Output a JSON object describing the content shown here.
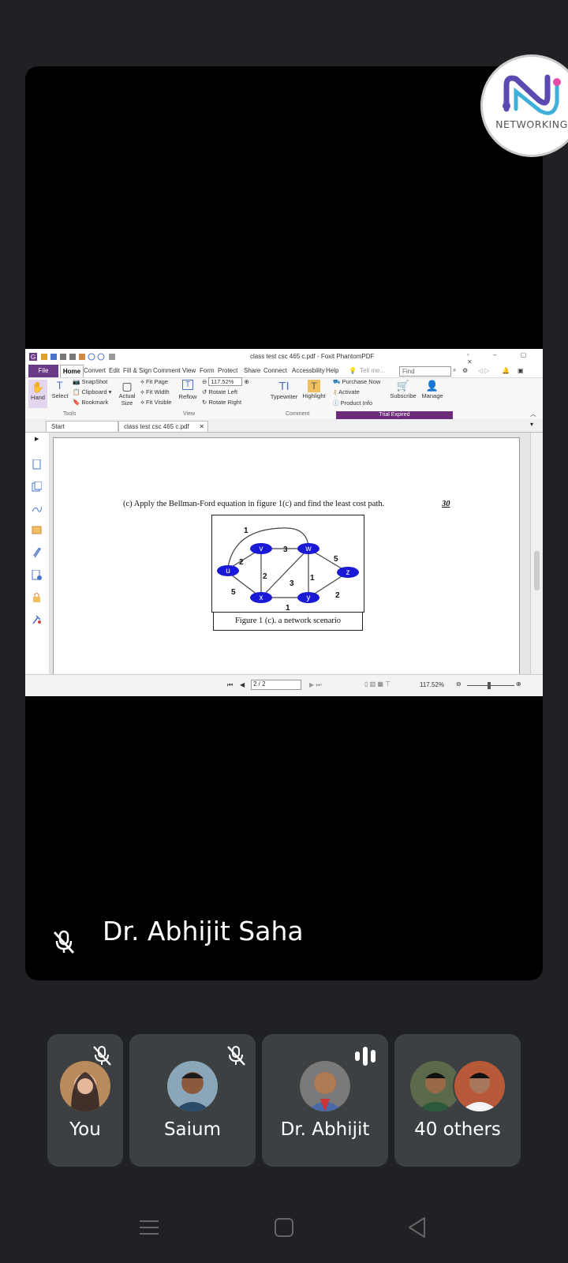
{
  "badge": {
    "label": "NETWORKING"
  },
  "pdf": {
    "window_title": "class test csc 465 c.pdf - Foxit PhantomPDF",
    "menu": [
      "File",
      "Home",
      "Convert",
      "Edit",
      "Fill & Sign",
      "Comment",
      "View",
      "Form",
      "Protect",
      "Share",
      "Connect",
      "Accessbility",
      "Help"
    ],
    "tell_me": "Tell me...",
    "find_placeholder": "Find",
    "ribbon": {
      "hand": "Hand",
      "select": "Select",
      "snapshot": "SnapShot",
      "clipboard": "Clipboard",
      "bookmark": "Bookmark",
      "actual_size": "Actual Size",
      "fit_page": "Fit Page",
      "fit_width": "Fit Width",
      "fit_visible": "Fit Visible",
      "reflow": "Reflow",
      "zoom": "117.52%",
      "rotate_left": "Rotate Left",
      "rotate_right": "Rotate Right",
      "typewriter": "Typewriter",
      "highlight": "Highlight",
      "purchase_now": "Purchase Now",
      "activate": "Activate",
      "product_info": "Product Info",
      "subscribe": "Subscribe",
      "manage": "Manage",
      "group_tools": "Tools",
      "group_view": "View",
      "group_comment": "Comment",
      "trial_expired": "Trial Expired"
    },
    "tabs": [
      "Start",
      "class test csc 465 c.pdf"
    ],
    "document": {
      "question": "(c)  Apply the Bellman-Ford equation in figure 1(c) and find the least cost path.",
      "marks": "30",
      "caption": "Figure 1 (c). a network scenario",
      "nodes": [
        "u",
        "v",
        "w",
        "x",
        "y",
        "z"
      ],
      "edge_labels": {
        "u_w": "1",
        "u_v": "2",
        "u_x": "5",
        "v_w": "3",
        "v_x": "2",
        "w_z": "5",
        "w_x": "3",
        "w_y": "1",
        "x_y": "1",
        "y_z": "2"
      }
    },
    "status": {
      "page": "2 / 2",
      "zoom": "117.52%"
    }
  },
  "presenter": {
    "name": "Dr. Abhijit Saha"
  },
  "participants": [
    {
      "name": "You"
    },
    {
      "name": "Saium"
    },
    {
      "name": "Dr. Abhijit"
    },
    {
      "name": "40 others"
    }
  ]
}
